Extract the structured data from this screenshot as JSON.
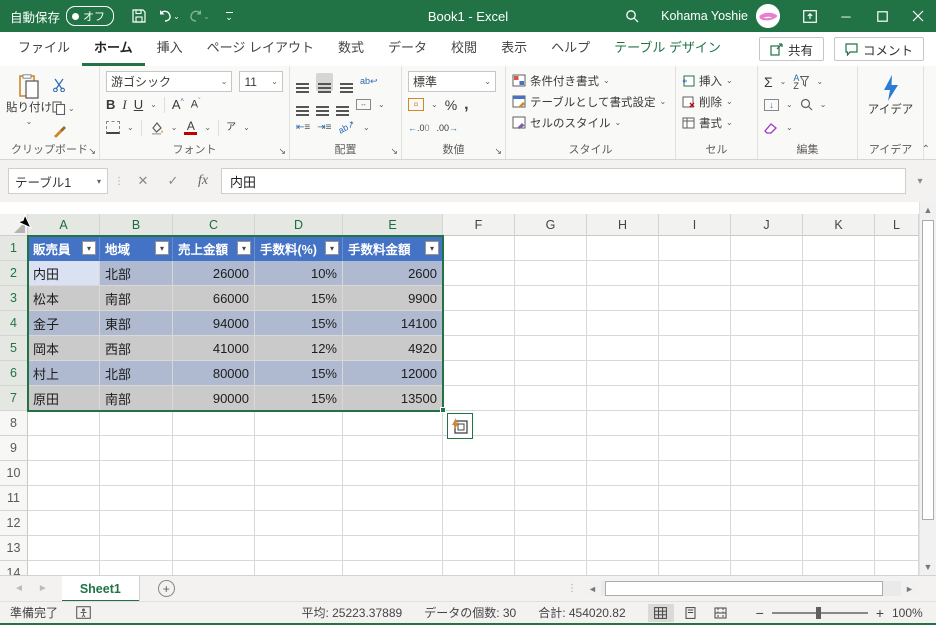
{
  "window": {
    "autosave_label": "自動保存",
    "autosave_state": "オフ",
    "title": "Book1  -  Excel",
    "user": "Kohama Yoshie"
  },
  "ribbon_tabs": [
    {
      "label": "ファイル",
      "state": "normal"
    },
    {
      "label": "ホーム",
      "state": "active"
    },
    {
      "label": "挿入",
      "state": "normal"
    },
    {
      "label": "ページ レイアウト",
      "state": "normal"
    },
    {
      "label": "数式",
      "state": "normal"
    },
    {
      "label": "データ",
      "state": "normal"
    },
    {
      "label": "校閲",
      "state": "normal"
    },
    {
      "label": "表示",
      "state": "normal"
    },
    {
      "label": "ヘルプ",
      "state": "normal"
    },
    {
      "label": "テーブル デザイン",
      "state": "contextual"
    }
  ],
  "actions": {
    "share": "共有",
    "comment": "コメント"
  },
  "ribbon": {
    "clipboard": {
      "paste": "貼り付け",
      "label": "クリップボード"
    },
    "font": {
      "name": "游ゴシック",
      "size": "11",
      "label": "フォント",
      "phonetic": "ア"
    },
    "alignment": {
      "label": "配置"
    },
    "number": {
      "format": "標準",
      "label": "数値",
      "dec_inc": "←.0",
      "dec_dec": ".00→"
    },
    "styles": {
      "conditional": "条件付き書式",
      "format_table": "テーブルとして書式設定",
      "cell_styles": "セルのスタイル",
      "label": "スタイル"
    },
    "cells": {
      "insert": "挿入",
      "delete": "削除",
      "format": "書式",
      "label": "セル"
    },
    "editing": {
      "label": "編集"
    },
    "ideas": {
      "button": "アイデア",
      "label": "アイデア"
    }
  },
  "formula_bar": {
    "name_box": "テーブル1",
    "content": "内田"
  },
  "grid": {
    "columns": [
      "A",
      "B",
      "C",
      "D",
      "E",
      "F",
      "G",
      "H",
      "I",
      "J",
      "K",
      "L"
    ],
    "selected_columns": [
      "A",
      "B",
      "C",
      "D",
      "E"
    ],
    "row_count": 14,
    "selected_rows": [
      1,
      2,
      3,
      4,
      5,
      6,
      7
    ]
  },
  "table": {
    "headers": [
      "販売員",
      "地域",
      "売上金額",
      "手数料(%)",
      "手数料金額"
    ],
    "rows": [
      [
        "内田",
        "北部",
        "26000",
        "10%",
        "2600"
      ],
      [
        "松本",
        "南部",
        "66000",
        "15%",
        "9900"
      ],
      [
        "金子",
        "東部",
        "94000",
        "15%",
        "14100"
      ],
      [
        "岡本",
        "西部",
        "41000",
        "12%",
        "4920"
      ],
      [
        "村上",
        "北部",
        "80000",
        "15%",
        "12000"
      ],
      [
        "原田",
        "南部",
        "90000",
        "15%",
        "13500"
      ]
    ]
  },
  "colors": {
    "accent": "#217346",
    "table_header": "#4472c4",
    "band_selected": "#afb9cf",
    "plain_selected": "#cacaca",
    "active_cell": "#d9e1f2"
  },
  "sheet_tabs": {
    "active": "Sheet1"
  },
  "status_bar": {
    "mode": "準備完了",
    "average": "平均: 25223.37889",
    "count": "データの個数: 30",
    "sum": "合計: 454020.82",
    "zoom": "100%"
  }
}
